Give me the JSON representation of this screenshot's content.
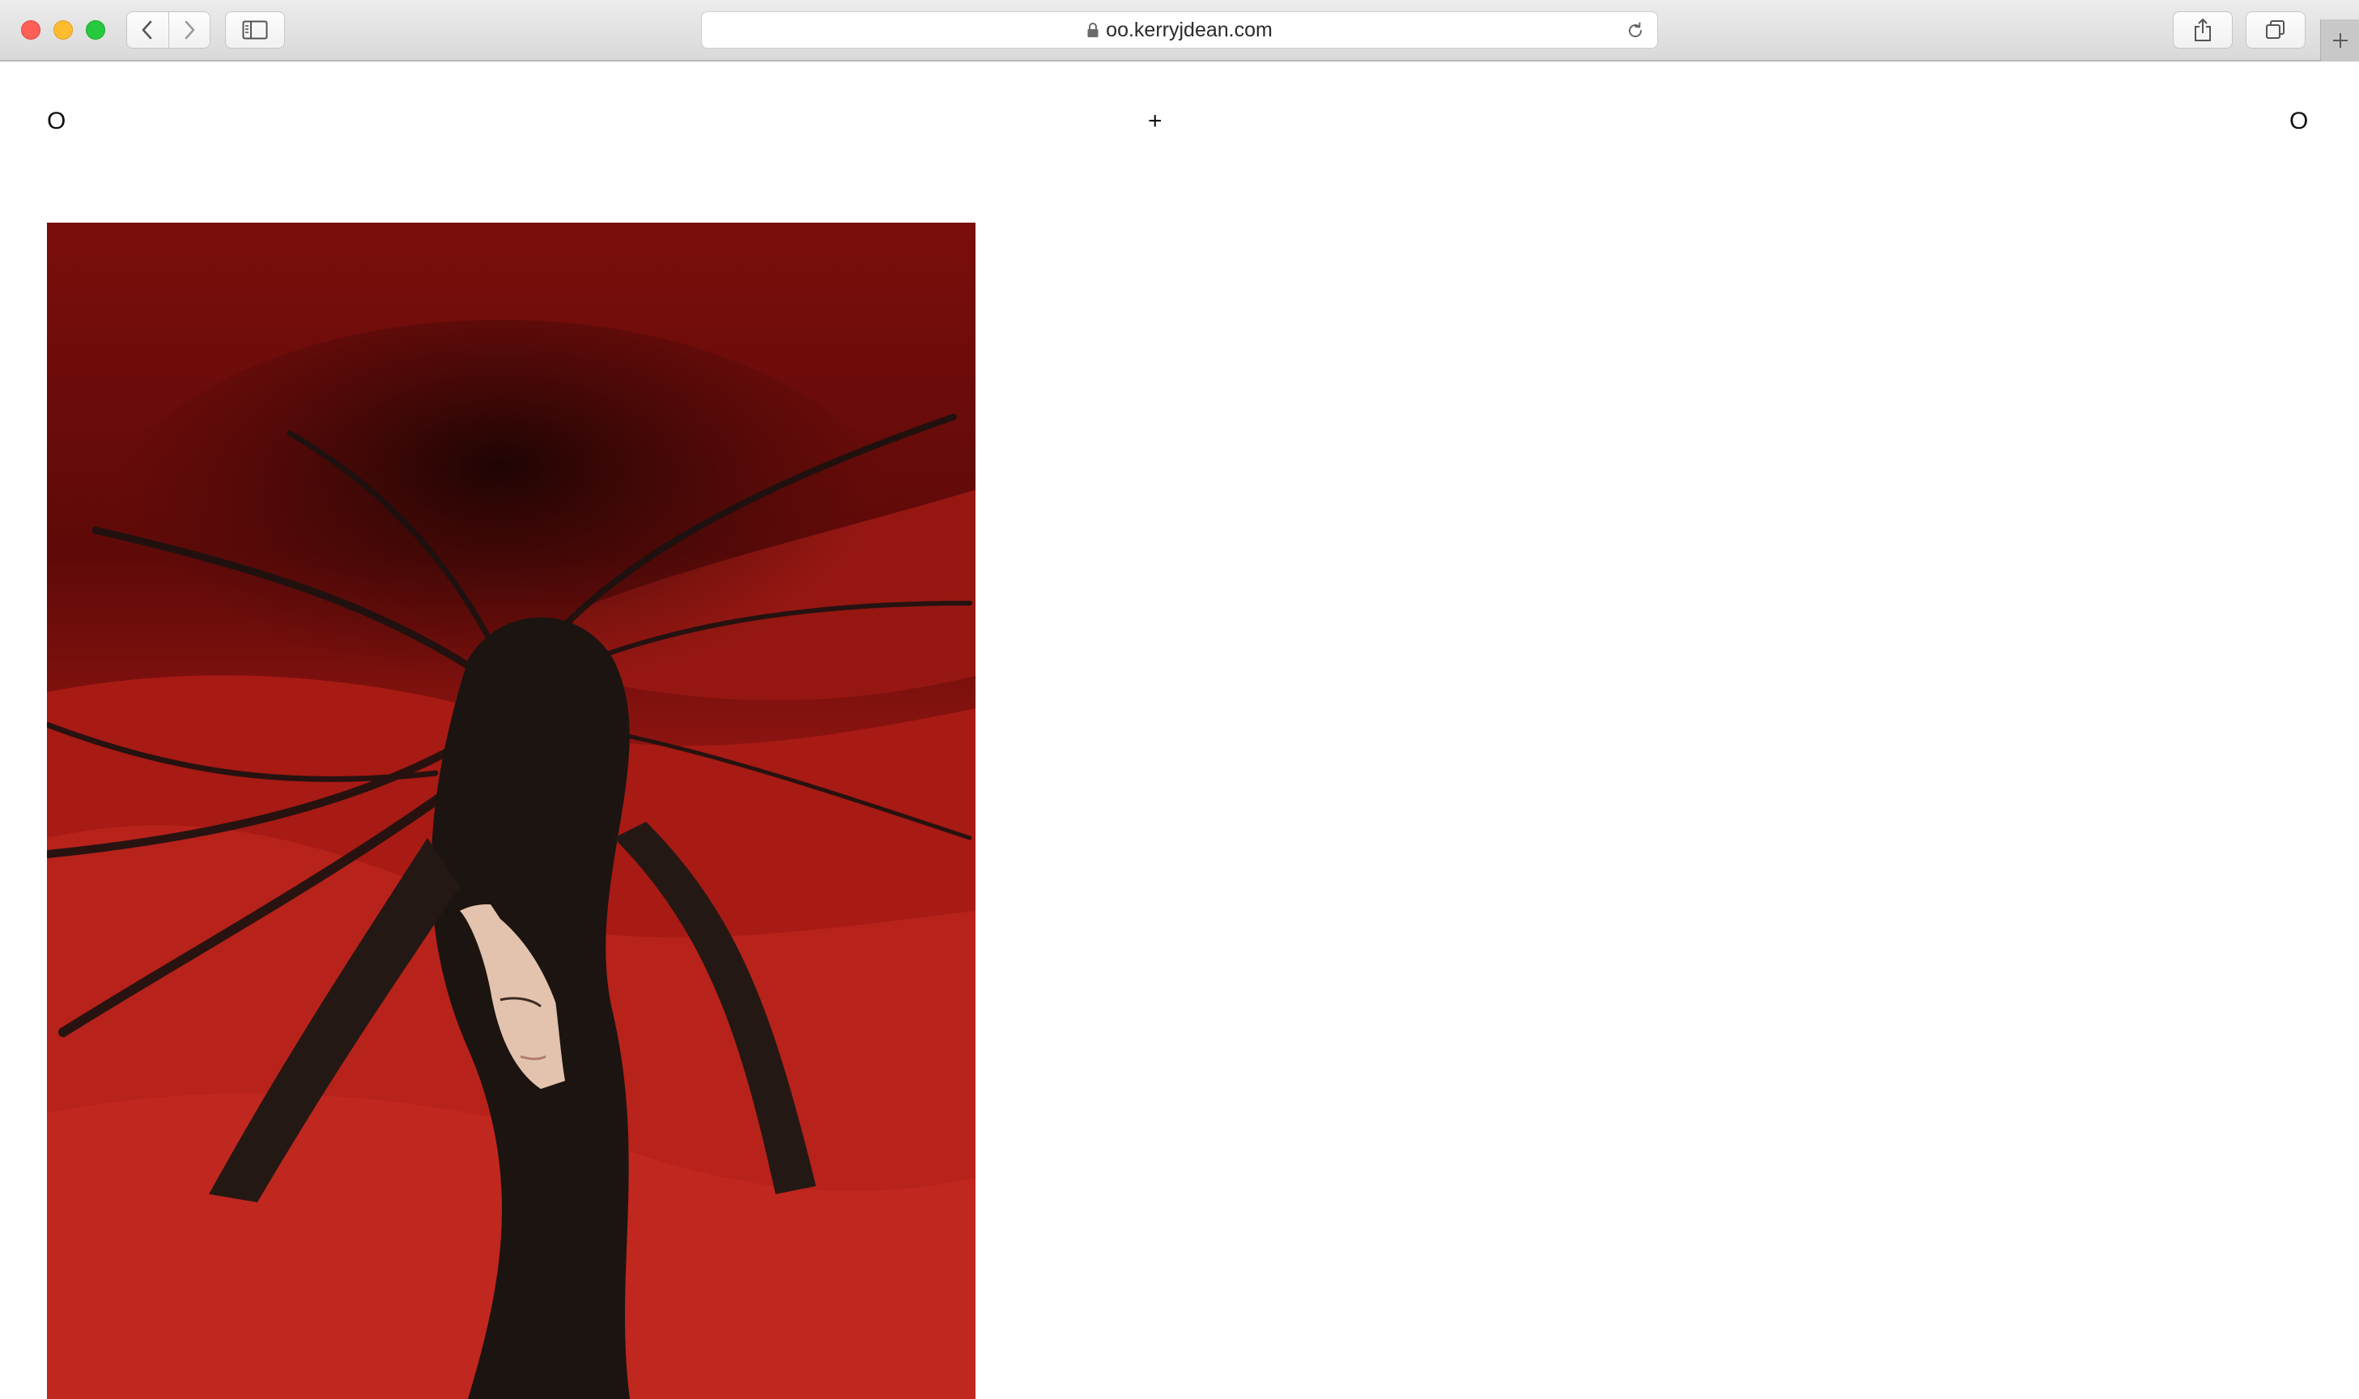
{
  "browser": {
    "address_url": "oo.kerryjdean.com",
    "icons": {
      "back": "chevron-left-icon",
      "forward": "chevron-right-icon",
      "sidebar": "sidebar-icon",
      "lock": "lock-icon",
      "reload": "reload-icon",
      "share": "share-icon",
      "tabs": "tabs-overview-icon",
      "new_tab": "plus-icon"
    },
    "colors": {
      "close": "#fe5f57",
      "minimize": "#febc2e",
      "zoom": "#28c840"
    }
  },
  "site": {
    "header_left": "O",
    "header_center": "+",
    "header_right": "O"
  },
  "photo": {
    "colors": {
      "backdrop": "#b01c16",
      "shadow": "#3d0806",
      "hair": "#1a1210",
      "skin": "#e3c3ad"
    }
  }
}
